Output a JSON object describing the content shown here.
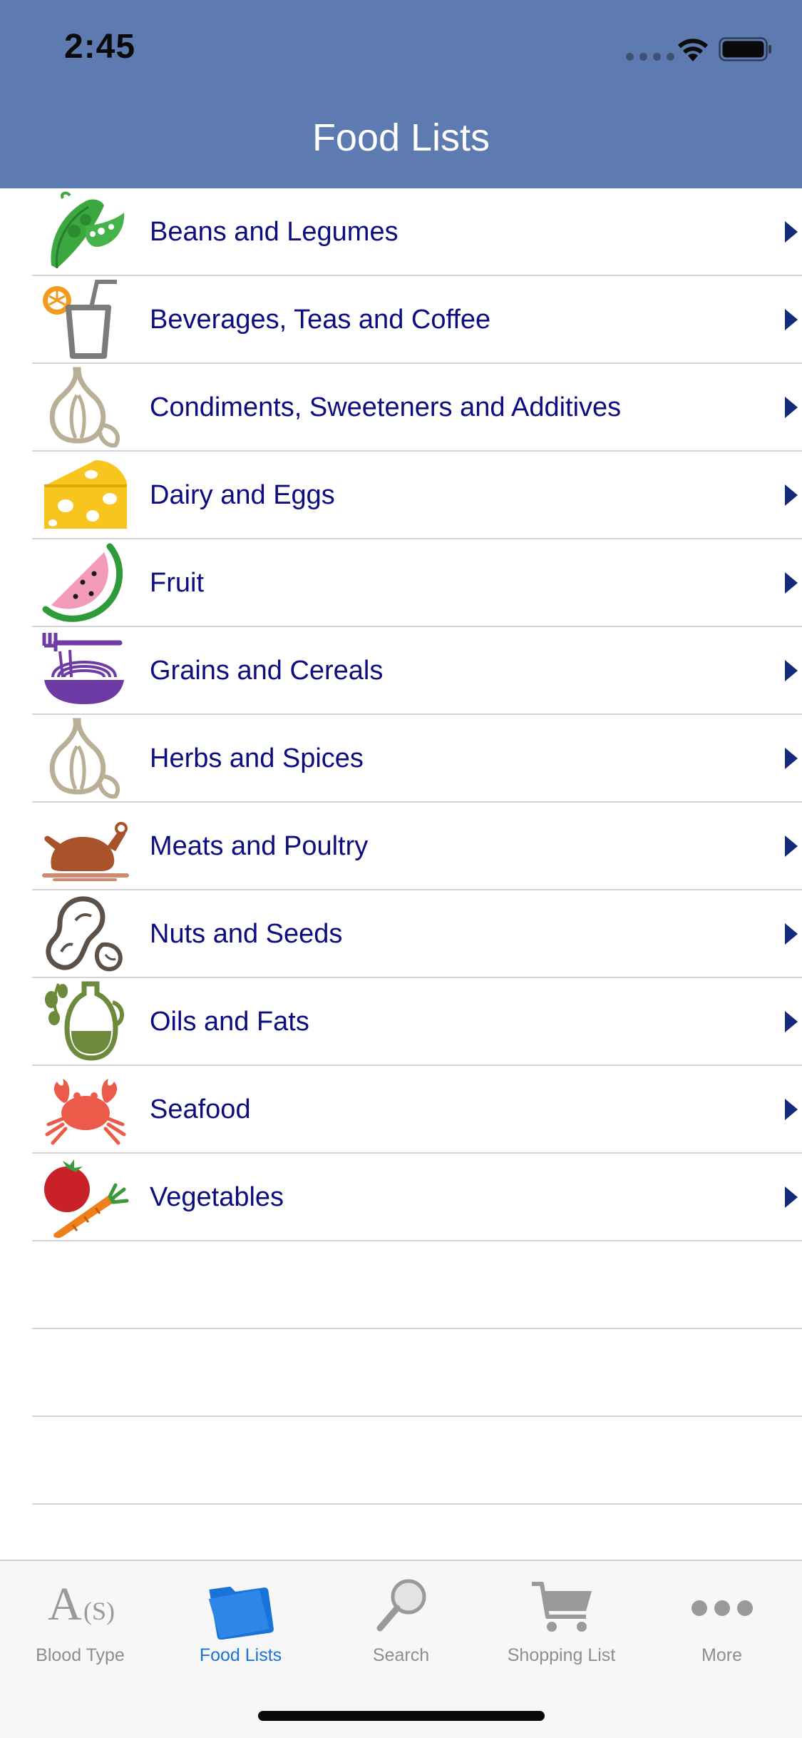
{
  "status_bar": {
    "time": "2:45"
  },
  "nav": {
    "title": "Food Lists"
  },
  "colors": {
    "header": "#5d7bb0",
    "row_text": "#0c0c80",
    "tab_active": "#1a73d8",
    "tab_inactive": "#8e8e8e"
  },
  "food_categories": [
    {
      "label": "Beans and Legumes",
      "icon": "pea-pod-icon"
    },
    {
      "label": "Beverages, Teas and Coffee",
      "icon": "beverage-cup-icon"
    },
    {
      "label": "Condiments, Sweeteners and Additives",
      "icon": "garlic-icon"
    },
    {
      "label": "Dairy and Eggs",
      "icon": "cheese-icon"
    },
    {
      "label": "Fruit",
      "icon": "watermelon-icon"
    },
    {
      "label": "Grains and Cereals",
      "icon": "pasta-bowl-icon"
    },
    {
      "label": "Herbs and Spices",
      "icon": "garlic-icon"
    },
    {
      "label": "Meats and Poultry",
      "icon": "roast-chicken-icon"
    },
    {
      "label": "Nuts and Seeds",
      "icon": "peanut-icon"
    },
    {
      "label": "Oils and Fats",
      "icon": "olive-oil-icon"
    },
    {
      "label": "Seafood",
      "icon": "crab-icon"
    },
    {
      "label": "Vegetables",
      "icon": "tomato-carrot-icon"
    }
  ],
  "tabs": [
    {
      "label": "Blood Type",
      "icon": "blood-type-icon",
      "active": false
    },
    {
      "label": "Food Lists",
      "icon": "folder-icon",
      "active": true
    },
    {
      "label": "Search",
      "icon": "magnifier-icon",
      "active": false
    },
    {
      "label": "Shopping List",
      "icon": "cart-icon",
      "active": false
    },
    {
      "label": "More",
      "icon": "more-dots-icon",
      "active": false
    }
  ]
}
